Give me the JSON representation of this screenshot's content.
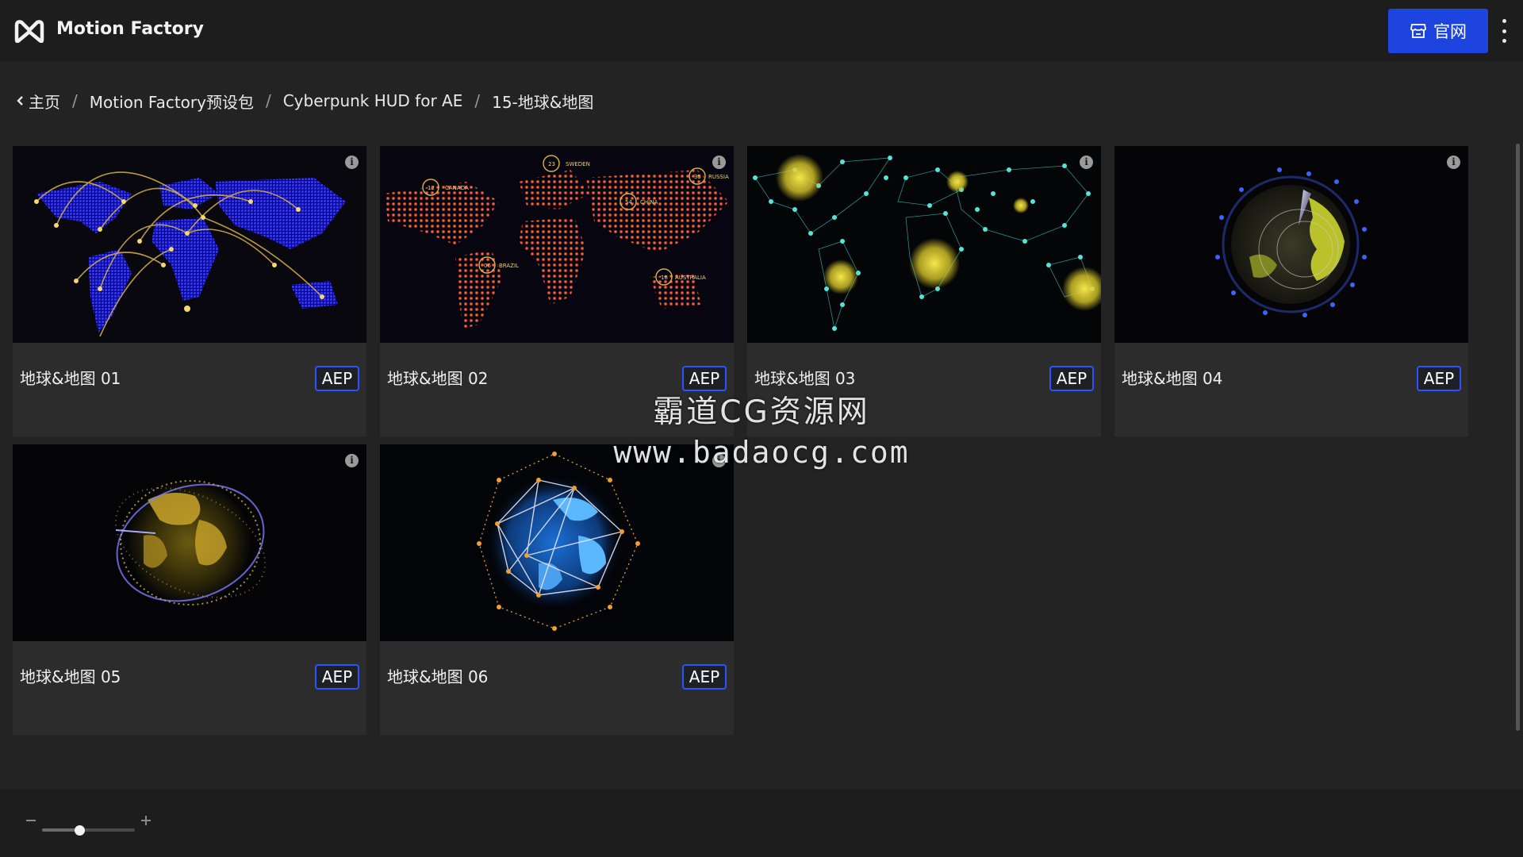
{
  "app": {
    "name": "Motion Factory"
  },
  "header": {
    "site_button_label": "官网"
  },
  "breadcrumb": {
    "items": [
      "主页",
      "Motion Factory预设包",
      "Cyberpunk HUD for AE",
      "15-地球&地图"
    ]
  },
  "cards": [
    {
      "title": "地球&地图 01",
      "badge": "AEP"
    },
    {
      "title": "地球&地图 02",
      "badge": "AEP"
    },
    {
      "title": "地球&地图 03",
      "badge": "AEP"
    },
    {
      "title": "地球&地图 04",
      "badge": "AEP"
    },
    {
      "title": "地球&地图 05",
      "badge": "AEP"
    },
    {
      "title": "地球&地图 06",
      "badge": "AEP"
    }
  ],
  "map_labels": {
    "canada": "CANADA",
    "canada_n": "12",
    "sweden": "SWEDEN",
    "sweden_n": "23",
    "russia": "RUSSIA",
    "russia_n": "35",
    "china": "CHINA",
    "china_n": "54",
    "brazil": "BRAZIL",
    "brazil_n": "06",
    "australia": "AUSTRALIA",
    "australia_n": "18"
  },
  "watermark": {
    "line1": "霸道CG资源网",
    "line2": "www.badaocg.com"
  },
  "zoom": {
    "level": 0.4
  },
  "colors": {
    "accent": "#1e44e0",
    "badge_border": "#2b54ff",
    "background": "#232323"
  }
}
